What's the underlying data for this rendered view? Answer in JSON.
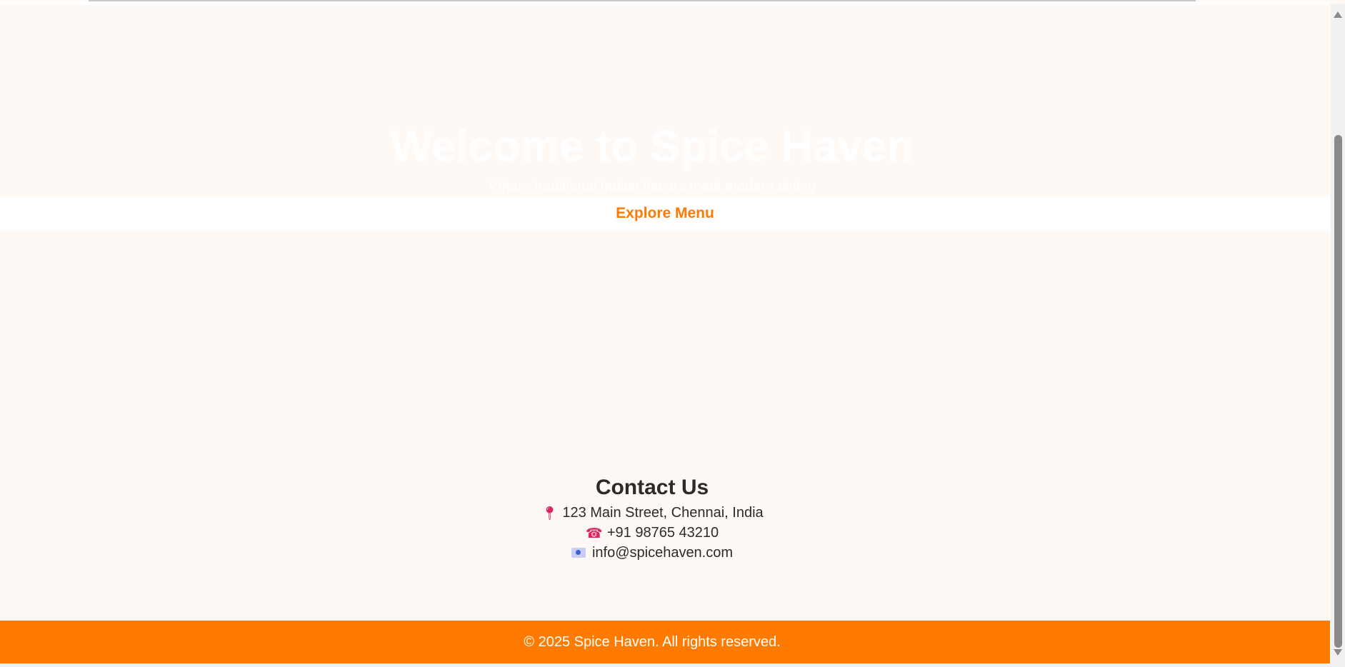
{
  "hero": {
    "title": "Welcome to Spice Haven",
    "subtitle": "Where traditional Indian flavors meet modern dining",
    "cta_label": "Explore Menu"
  },
  "contact": {
    "heading": "Contact Us",
    "address": "123 Main Street, Chennai, India",
    "phone": "+91 98765 43210",
    "email": "info@spicehaven.com",
    "icons": [
      "pin-icon",
      "phone-icon",
      "email-icon"
    ]
  },
  "footer": {
    "copyright": "© 2025 Spice Haven. All rights reserved."
  },
  "colors": {
    "accent": "#ff7a00",
    "background": "#fff9f5",
    "text": "#2b2b2b"
  },
  "scrollbar": {
    "position_fraction": 0.22
  }
}
